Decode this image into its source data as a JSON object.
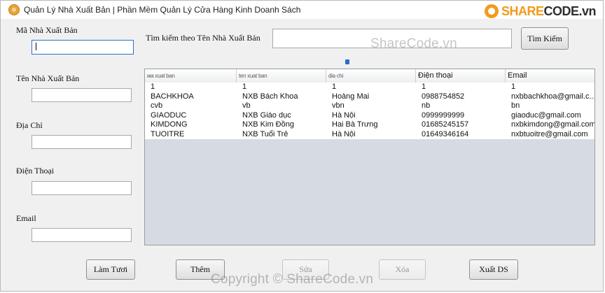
{
  "window": {
    "title": "Quản Lý Nhà Xuất Bản | Phần Mềm Quản Lý Cửa Hàng Kinh Doanh Sách",
    "minimize": "—",
    "maximize": "☐",
    "close": "✕"
  },
  "brand": {
    "logo_prefix": "SHARE",
    "logo_suffix": "CODE.vn"
  },
  "form": {
    "ma_nxb_label": "Mã Nhà Xuất Bản",
    "ten_nxb_label": "Tên Nhà Xuất Bản",
    "dia_chi_label": "Địa Chỉ",
    "dien_thoai_label": "Điện Thoại",
    "email_label": "Email",
    "ma_nxb_value": "",
    "ten_nxb_value": "",
    "dia_chi_value": "",
    "dien_thoai_value": "",
    "email_value": ""
  },
  "search": {
    "label": "Tìm kiếm theo Tên Nhà Xuất Bản",
    "value": "",
    "button": "Tìm Kiếm"
  },
  "table": {
    "headers": [
      "ма xuat ban",
      "ten xuat ban",
      "dia chi",
      "Điện thoại",
      "Email"
    ],
    "rows": [
      [
        "1",
        "1",
        "1",
        "1",
        "1"
      ],
      [
        "BACHKHOA",
        "NXB Bách Khoa",
        "Hoàng Mai",
        "0988754852",
        "nxbbachkhoa@gmail.c..."
      ],
      [
        "cvb",
        "vb",
        "vbn",
        "nb",
        "bn"
      ],
      [
        "GIAODUC",
        "NXB Giáo dục",
        "Hà Nội",
        "0999999999",
        "giaoduc@gmail.com"
      ],
      [
        "KIMDONG",
        "NXB Kim Đồng",
        "Hai Bà Trưng",
        "01685245157",
        "nxbkimdong@gmail.com"
      ],
      [
        "TUOITRE",
        "NXB Tuổi Trẻ",
        "Hà Nội",
        "01649346164",
        "nxbtuoitre@gmail.com"
      ]
    ]
  },
  "buttons": {
    "refresh": "Làm Tươi",
    "add": "Thêm",
    "edit": "Sửa",
    "delete": "Xóa",
    "export": "Xuất DS"
  },
  "watermarks": {
    "top": "ShareCode.vn",
    "bottom": "Copyright © ShareCode.vn"
  }
}
